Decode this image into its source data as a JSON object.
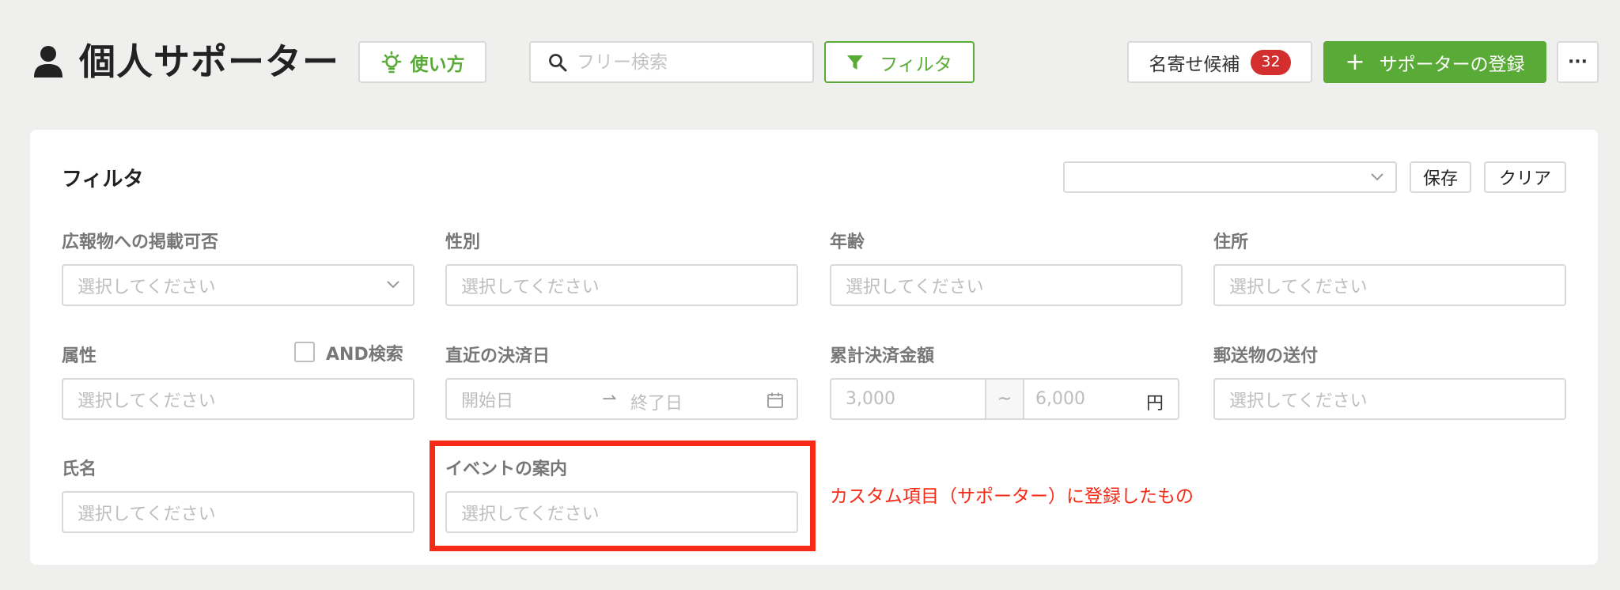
{
  "header": {
    "title": "個人サポーター",
    "howto_label": "使い方",
    "search_placeholder": "フリー検索",
    "filter_label": "フィルタ",
    "merge_label": "名寄せ候補",
    "merge_count": "32",
    "register_label": "サポーターの登録",
    "more_label": "···"
  },
  "panel": {
    "title": "フィルタ",
    "preset_value": "",
    "save_label": "保存",
    "clear_label": "クリア",
    "fields": {
      "publish": {
        "label": "広報物への掲載可否",
        "placeholder": "選択してください"
      },
      "gender": {
        "label": "性別",
        "placeholder": "選択してください"
      },
      "age": {
        "label": "年齢",
        "placeholder": "選択してください"
      },
      "address": {
        "label": "住所",
        "placeholder": "選択してください"
      },
      "attribute": {
        "label": "属性",
        "placeholder": "選択してください",
        "and_label": "AND検索"
      },
      "recent_payment": {
        "label": "直近の決済日",
        "start_placeholder": "開始日",
        "end_placeholder": "終了日"
      },
      "total_amount": {
        "label": "累計決済金額",
        "min_placeholder": "3,000",
        "separator": "~",
        "max_placeholder": "6,000",
        "unit": "円"
      },
      "mail": {
        "label": "郵送物の送付",
        "placeholder": "選択してください"
      },
      "name": {
        "label": "氏名",
        "placeholder": "選択してください"
      },
      "event": {
        "label": "イベントの案内",
        "placeholder": "選択してください"
      }
    },
    "annotation": "カスタム項目（サポーター）に登録したもの"
  },
  "colors": {
    "accent_green": "#5aaa37",
    "badge_red": "#d32f2f",
    "annotation_red": "#f52a17",
    "background": "#efefee"
  },
  "icons": {
    "title": "person-icon",
    "howto": "lightbulb-icon",
    "search": "search-icon",
    "filter": "funnel-icon",
    "register": "plus-icon",
    "select": "chevron-down-icon",
    "date": "calendar-icon"
  }
}
